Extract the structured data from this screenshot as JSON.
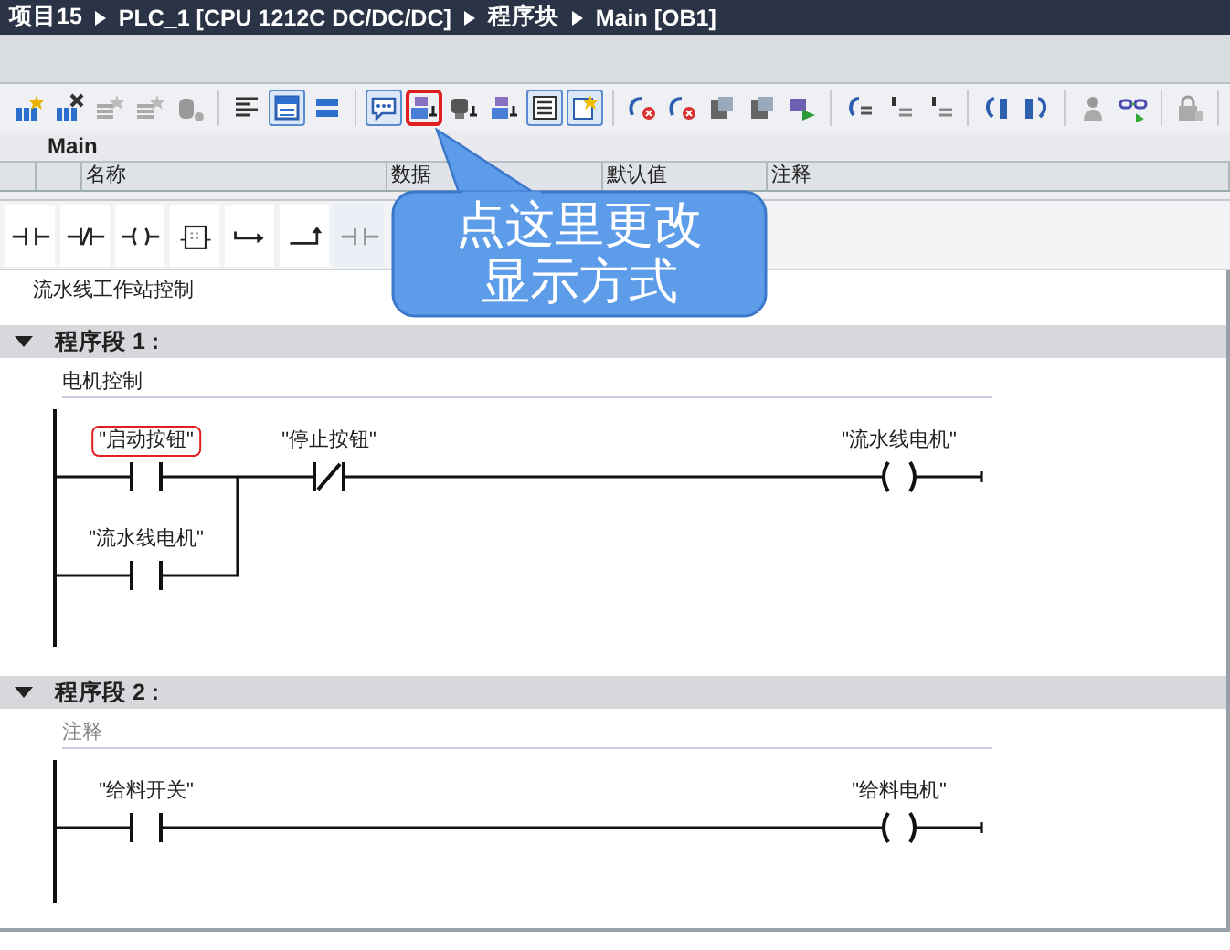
{
  "breadcrumb": [
    "项目15",
    "PLC_1 [CPU 1212C DC/DC/DC]",
    "程序块",
    "Main [OB1]"
  ],
  "toolbar": [
    [
      {
        "kind": "network-add",
        "pressed": false,
        "highlighted": false
      },
      {
        "kind": "network-delete",
        "pressed": false,
        "highlighted": false
      },
      {
        "kind": "gray-star",
        "pressed": false,
        "highlighted": false
      },
      {
        "kind": "gray-star",
        "pressed": false,
        "highlighted": false
      },
      {
        "kind": "gray-cylinder",
        "pressed": false,
        "highlighted": false
      }
    ],
    [
      {
        "kind": "lines",
        "pressed": false,
        "highlighted": false
      },
      {
        "kind": "window",
        "pressed": true,
        "highlighted": false
      },
      {
        "kind": "bars",
        "pressed": false,
        "highlighted": false
      }
    ],
    [
      {
        "kind": "bubble",
        "pressed": true,
        "highlighted": false
      },
      {
        "kind": "display",
        "pressed": false,
        "highlighted": true
      },
      {
        "kind": "monitor",
        "pressed": false,
        "highlighted": false
      },
      {
        "kind": "display",
        "pressed": false,
        "highlighted": false
      },
      {
        "kind": "list",
        "pressed": true,
        "highlighted": false
      },
      {
        "kind": "star-doc",
        "pressed": true,
        "highlighted": false
      }
    ],
    [
      {
        "kind": "arrow-x",
        "pressed": false,
        "highlighted": false
      },
      {
        "kind": "arrow-x",
        "pressed": false,
        "highlighted": false
      },
      {
        "kind": "block",
        "pressed": false,
        "highlighted": false
      },
      {
        "kind": "block",
        "pressed": false,
        "highlighted": false
      },
      {
        "kind": "check",
        "pressed": false,
        "highlighted": false
      }
    ],
    [
      {
        "kind": "arrow-lines",
        "pressed": false,
        "highlighted": false
      },
      {
        "kind": "indent",
        "pressed": false,
        "highlighted": false
      },
      {
        "kind": "indent",
        "pressed": false,
        "highlighted": false
      }
    ],
    [
      {
        "kind": "jump-left",
        "pressed": false,
        "highlighted": false
      },
      {
        "kind": "jump-right",
        "pressed": false,
        "highlighted": false
      }
    ],
    [
      {
        "kind": "person",
        "pressed": false,
        "highlighted": false
      },
      {
        "kind": "glasses",
        "pressed": false,
        "highlighted": false
      }
    ],
    [
      {
        "kind": "lock",
        "pressed": false,
        "highlighted": false
      }
    ]
  ],
  "block": {
    "name": "Main",
    "columns": [
      "名称",
      "数据",
      "默认值",
      "注释"
    ]
  },
  "instructions": [
    {
      "kind": "contact_no",
      "disabled": false
    },
    {
      "kind": "contact_nc",
      "disabled": false
    },
    {
      "kind": "coil",
      "disabled": false
    },
    {
      "kind": "box",
      "disabled": false
    },
    {
      "kind": "branch_open",
      "disabled": false
    },
    {
      "kind": "branch_close",
      "disabled": false
    },
    {
      "kind": "contact_no",
      "disabled": true
    }
  ],
  "block_comment": "流水线工作站控制",
  "networks": [
    {
      "title": "程序段 1 :",
      "expanded": true,
      "comment": "电机控制",
      "elements": [
        {
          "kind": "contact_no",
          "operand": "\"启动按钮\"",
          "highlighted": true,
          "parallel": [
            {
              "kind": "contact_no",
              "operand": "\"流水线电机\"",
              "highlighted": false
            }
          ]
        },
        {
          "kind": "contact_nc",
          "operand": "\"停止按钮\"",
          "highlighted": false
        },
        {
          "kind": "coil",
          "operand": "\"流水线电机\"",
          "highlighted": false
        }
      ]
    },
    {
      "title": "程序段 2 :",
      "expanded": true,
      "placeholder": "注释",
      "elements": [
        {
          "kind": "contact_no",
          "operand": "\"给料开关\"",
          "highlighted": false
        },
        {
          "kind": "coil",
          "operand": "\"给料电机\"",
          "highlighted": false
        }
      ]
    }
  ],
  "callout": {
    "lines": [
      "点这里更改",
      "显示方式"
    ]
  }
}
